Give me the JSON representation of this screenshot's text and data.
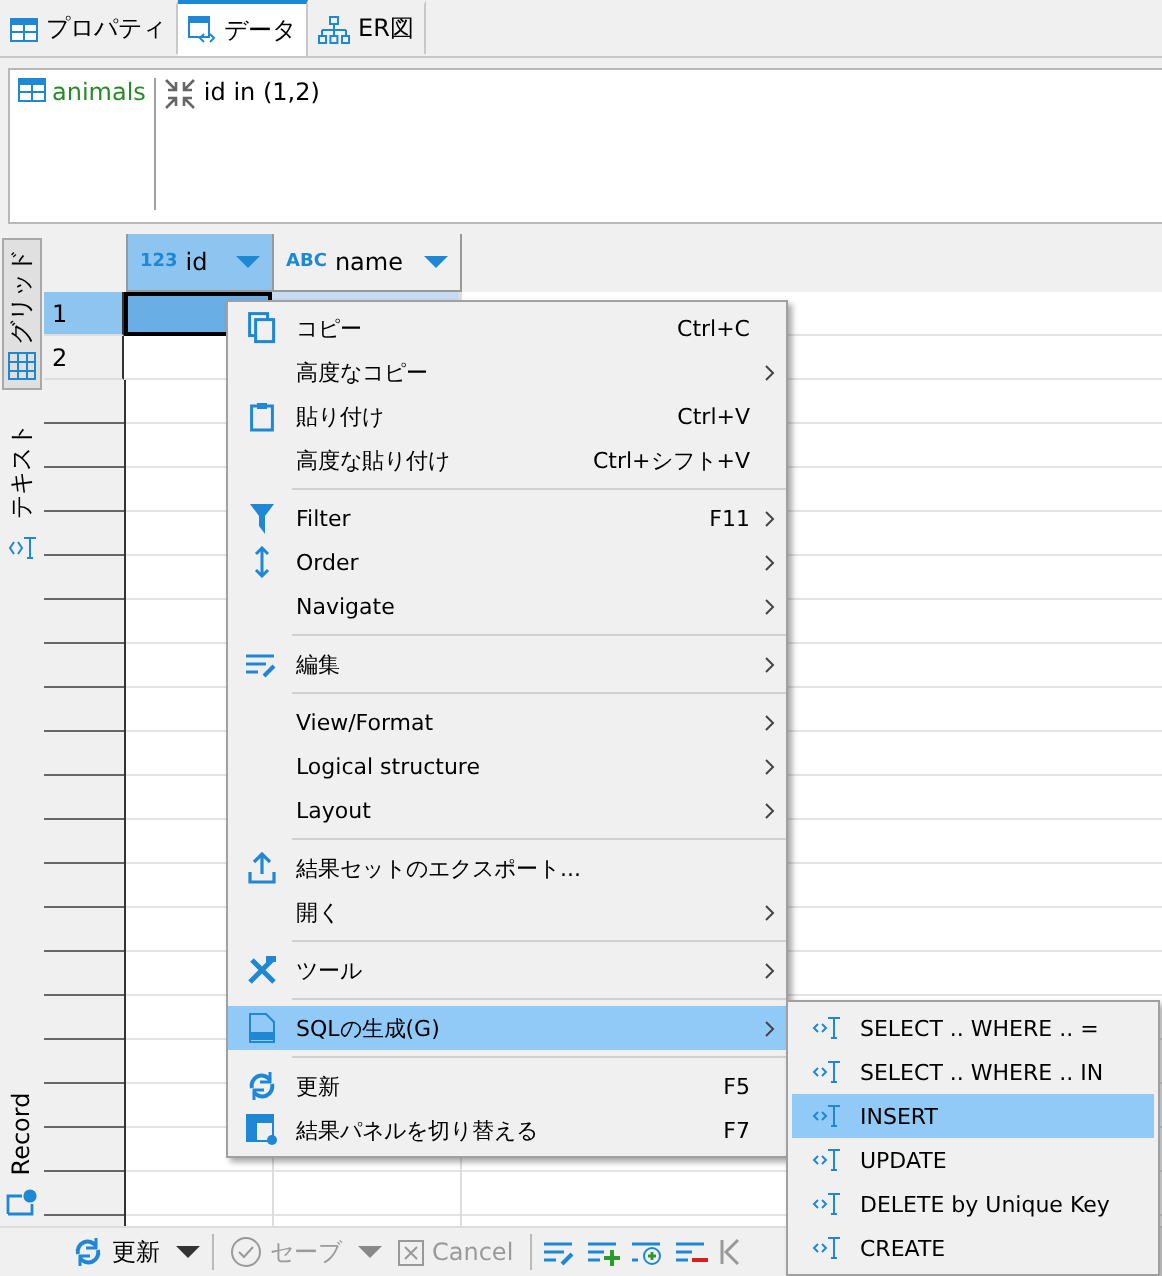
{
  "tabs": [
    {
      "label": "プロパティ",
      "selected": false
    },
    {
      "label": "データ",
      "selected": true
    },
    {
      "label": "ER図",
      "selected": false
    }
  ],
  "filter": {
    "table": "animals",
    "expression": "id in (1,2)"
  },
  "side_tabs": [
    {
      "label": "グリッド",
      "selected": true
    },
    {
      "label": "テキスト",
      "selected": false
    }
  ],
  "record_tab": {
    "label": "Record"
  },
  "grid": {
    "columns": [
      {
        "label": "id",
        "type_label": "123",
        "selected": true
      },
      {
        "label": "name",
        "type_label": "ABC",
        "selected": false
      }
    ],
    "rows": [
      {
        "number": "1",
        "selected": true
      },
      {
        "number": "2",
        "selected": false
      }
    ]
  },
  "context_menu": {
    "groups": [
      [
        {
          "label": "コピー",
          "shortcut": "Ctrl+C",
          "submenu": false,
          "selected": false
        },
        {
          "label": "高度なコピー",
          "submenu": true,
          "selected": false
        },
        {
          "label": "貼り付け",
          "shortcut": "Ctrl+V",
          "submenu": false,
          "selected": false
        },
        {
          "label": "高度な貼り付け",
          "shortcut": "Ctrl+シフト+V",
          "submenu": false,
          "selected": false
        }
      ],
      [
        {
          "label": "Filter",
          "shortcut": "F11",
          "submenu": true,
          "selected": false
        },
        {
          "label": "Order",
          "submenu": true,
          "selected": false
        },
        {
          "label": "Navigate",
          "submenu": true,
          "selected": false
        }
      ],
      [
        {
          "label": "編集",
          "submenu": true,
          "selected": false
        }
      ],
      [
        {
          "label": "View/Format",
          "submenu": true,
          "selected": false
        },
        {
          "label": "Logical structure",
          "submenu": true,
          "selected": false
        },
        {
          "label": "Layout",
          "submenu": true,
          "selected": false
        }
      ],
      [
        {
          "label": "結果セットのエクスポート...",
          "submenu": false,
          "selected": false
        },
        {
          "label": "開く",
          "submenu": true,
          "selected": false
        }
      ],
      [
        {
          "label": "ツール",
          "submenu": true,
          "selected": false
        }
      ],
      [
        {
          "label": "SQLの生成(G)",
          "submenu": true,
          "selected": true
        }
      ],
      [
        {
          "label": "更新",
          "shortcut": "F5",
          "submenu": false,
          "selected": false
        },
        {
          "label": "結果パネルを切り替える",
          "shortcut": "F7",
          "submenu": false,
          "selected": false
        }
      ]
    ]
  },
  "submenu": [
    {
      "label": "SELECT .. WHERE .. =",
      "selected": false
    },
    {
      "label": "SELECT .. WHERE .. IN",
      "selected": false
    },
    {
      "label": "INSERT",
      "selected": true
    },
    {
      "label": "UPDATE",
      "selected": false
    },
    {
      "label": "DELETE by Unique Key",
      "selected": false
    },
    {
      "label": "CREATE",
      "selected": false
    }
  ],
  "toolbar": {
    "refresh": {
      "label": "更新",
      "disabled": false
    },
    "save": {
      "label": "セーブ",
      "disabled": true
    },
    "cancel": {
      "label": "Cancel",
      "disabled": true
    }
  }
}
